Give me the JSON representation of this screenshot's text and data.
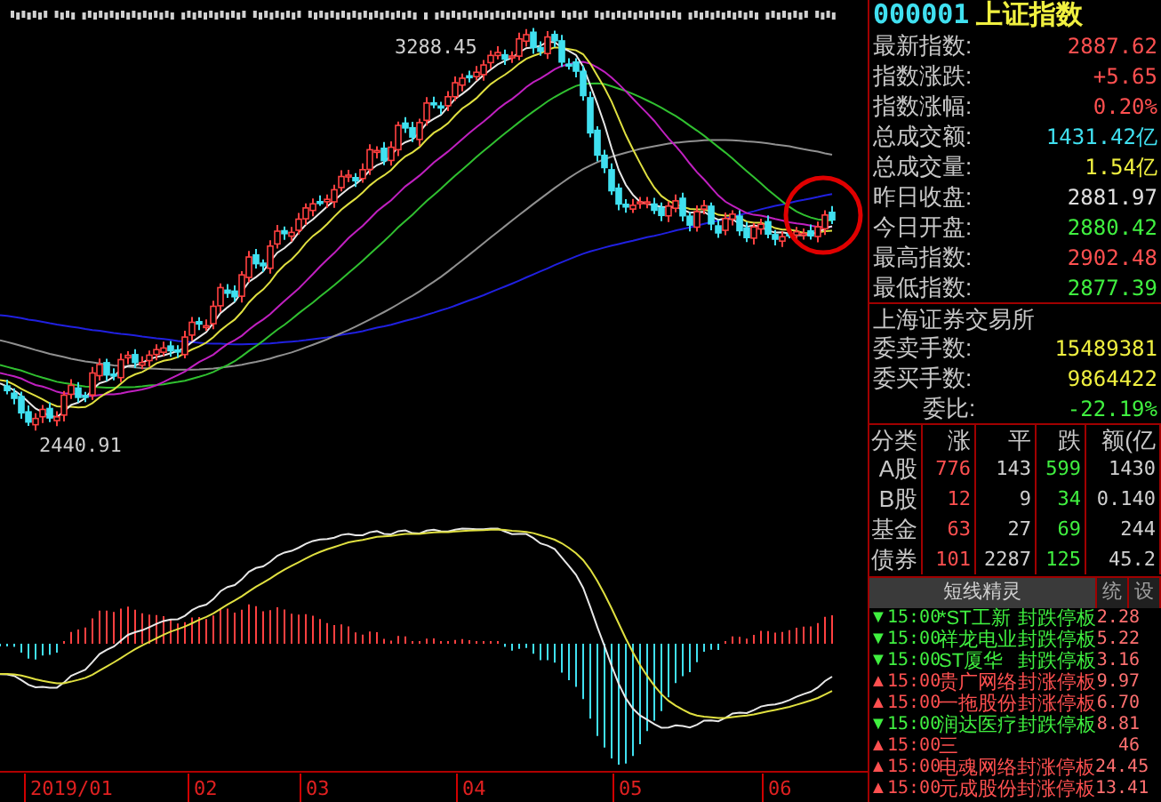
{
  "price_chart": {
    "high_label": "3288.45",
    "low_label": "2440.91",
    "highlight_circle": true
  },
  "time_axis": {
    "labels": [
      "2019/01",
      "02",
      "03",
      "04",
      "05",
      "06"
    ]
  },
  "quote_header": {
    "code": "000001",
    "name": "上证指数"
  },
  "quote_fields": [
    {
      "label": "最新指数:",
      "value": "2887.62",
      "color": "#ff5050"
    },
    {
      "label": "指数涨跌:",
      "value": "+5.65",
      "color": "#ff5050"
    },
    {
      "label": "指数涨幅:",
      "value": "0.20%",
      "color": "#ff5050"
    },
    {
      "label": "总成交额:",
      "value": "1431.42亿",
      "color": "#40e0f0"
    },
    {
      "label": "总成交量:",
      "value": "1.54亿",
      "color": "#f0f040"
    },
    {
      "label": "昨日收盘:",
      "value": "2881.97",
      "color": "#e0e0e0"
    },
    {
      "label": "今日开盘:",
      "value": "2880.42",
      "color": "#40f040"
    },
    {
      "label": "最高指数:",
      "value": "2902.48",
      "color": "#ff5050"
    },
    {
      "label": "最低指数:",
      "value": "2877.39",
      "color": "#40f040"
    }
  ],
  "exchange": "上海证券交易所",
  "order_fields": [
    {
      "label": "委卖手数:",
      "value": "15489381",
      "color": "#f0f040"
    },
    {
      "label": "委买手数:",
      "value": "9864422",
      "color": "#f0f040"
    },
    {
      "label": "委比:",
      "value": "-22.19%",
      "color": "#40f040"
    }
  ],
  "breadth_table": {
    "columns": [
      "分类",
      "涨",
      "平",
      "跌",
      "额(亿"
    ],
    "rows": [
      {
        "cells": [
          "A股",
          "776",
          "143",
          "599",
          "1430"
        ]
      },
      {
        "cells": [
          "B股",
          "12",
          "9",
          "34",
          "0.140"
        ]
      },
      {
        "cells": [
          "基金",
          "63",
          "27",
          "69",
          "244"
        ]
      },
      {
        "cells": [
          "债券",
          "101",
          "2287",
          "125",
          "45.2"
        ]
      }
    ]
  },
  "sprite_panel": {
    "tabs": [
      {
        "label": "短线精灵",
        "selected": true
      },
      {
        "label": "统",
        "selected": false
      },
      {
        "label": "设",
        "selected": false
      }
    ],
    "alerts": [
      {
        "kind": "down",
        "arrow": "▼",
        "time": "15:00",
        "stock": "*ST工新",
        "event": "封跌停板",
        "value": "2.28"
      },
      {
        "kind": "down",
        "arrow": "▼",
        "time": "15:00",
        "stock": "祥龙电业",
        "event": "封跌停板",
        "value": "5.22"
      },
      {
        "kind": "down",
        "arrow": "▼",
        "time": "15:00",
        "stock": "ST厦华",
        "event": "封跌停板",
        "value": "3.16"
      },
      {
        "kind": "up",
        "arrow": "▲",
        "time": "15:00",
        "stock": "贵广网络",
        "event": "封涨停板",
        "value": "9.97"
      },
      {
        "kind": "up",
        "arrow": "▲",
        "time": "15:00",
        "stock": "一拖股份",
        "event": "封涨停板",
        "value": "6.70"
      },
      {
        "kind": "down",
        "arrow": "▼",
        "time": "15:00",
        "stock": "润达医疗",
        "event": "封跌停板",
        "value": "8.81"
      },
      {
        "kind": "up",
        "arrow": "▲",
        "time": "15:00",
        "stock": "三",
        "value": "46"
      },
      {
        "kind": "up",
        "arrow": "▲",
        "time": "15:00",
        "stock": "电魂网络",
        "event": "封涨停板",
        "value": "24.45"
      },
      {
        "kind": "up",
        "arrow": "▲",
        "time": "15:00",
        "stock": "元成股份",
        "event": "封涨停板",
        "value": "13.41"
      }
    ]
  }
}
